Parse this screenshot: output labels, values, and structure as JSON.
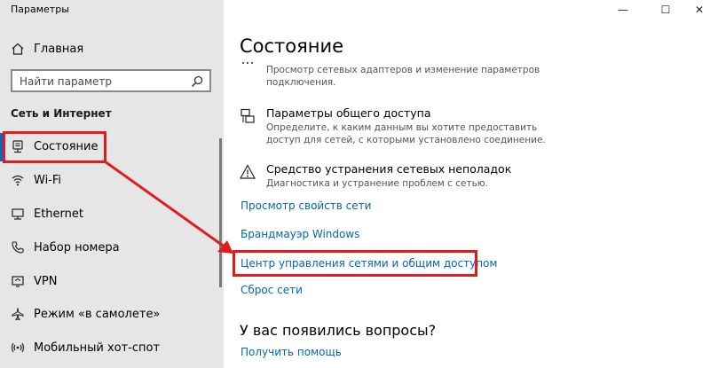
{
  "window": {
    "title": "Параметры",
    "controls": {
      "minimize": "—",
      "maximize": "☐",
      "close": "✕"
    }
  },
  "sidebar": {
    "home_label": "Главная",
    "search": {
      "placeholder": "Найти параметр"
    },
    "section_title": "Сеть и Интернет",
    "items": [
      {
        "label": "Состояние",
        "icon": "status-icon",
        "selected": true
      },
      {
        "label": "Wi-Fi",
        "icon": "wifi-icon"
      },
      {
        "label": "Ethernet",
        "icon": "ethernet-icon"
      },
      {
        "label": "Набор номера",
        "icon": "phone-icon"
      },
      {
        "label": "VPN",
        "icon": "vpn-icon"
      },
      {
        "label": "Режим «в самолете»",
        "icon": "airplane-icon"
      },
      {
        "label": "Мобильный хот-спот",
        "icon": "hotspot-icon"
      }
    ]
  },
  "main": {
    "title": "Состояние",
    "adapters": {
      "desc": "Просмотр сетевых адаптеров и изменение параметров подключения."
    },
    "sharing": {
      "title": "Параметры общего доступа",
      "desc": "Определите, к каким данным вы хотите предоставить доступ для сетей, с которыми установлено соединение."
    },
    "troubleshoot": {
      "title": "Средство устранения сетевых неполадок",
      "desc": "Диагностика и устранение проблем с сетью."
    },
    "links": [
      "Просмотр свойств сети",
      "Брандмауэр Windows",
      "Центр управления сетями и общим доступом",
      "Сброс сети"
    ],
    "questions": {
      "title": "У вас появились вопросы?",
      "help_link": "Получить помощь"
    }
  },
  "colors": {
    "accent": "#0b66c2",
    "link": "#0067b8",
    "highlight": "#e21c1c"
  }
}
